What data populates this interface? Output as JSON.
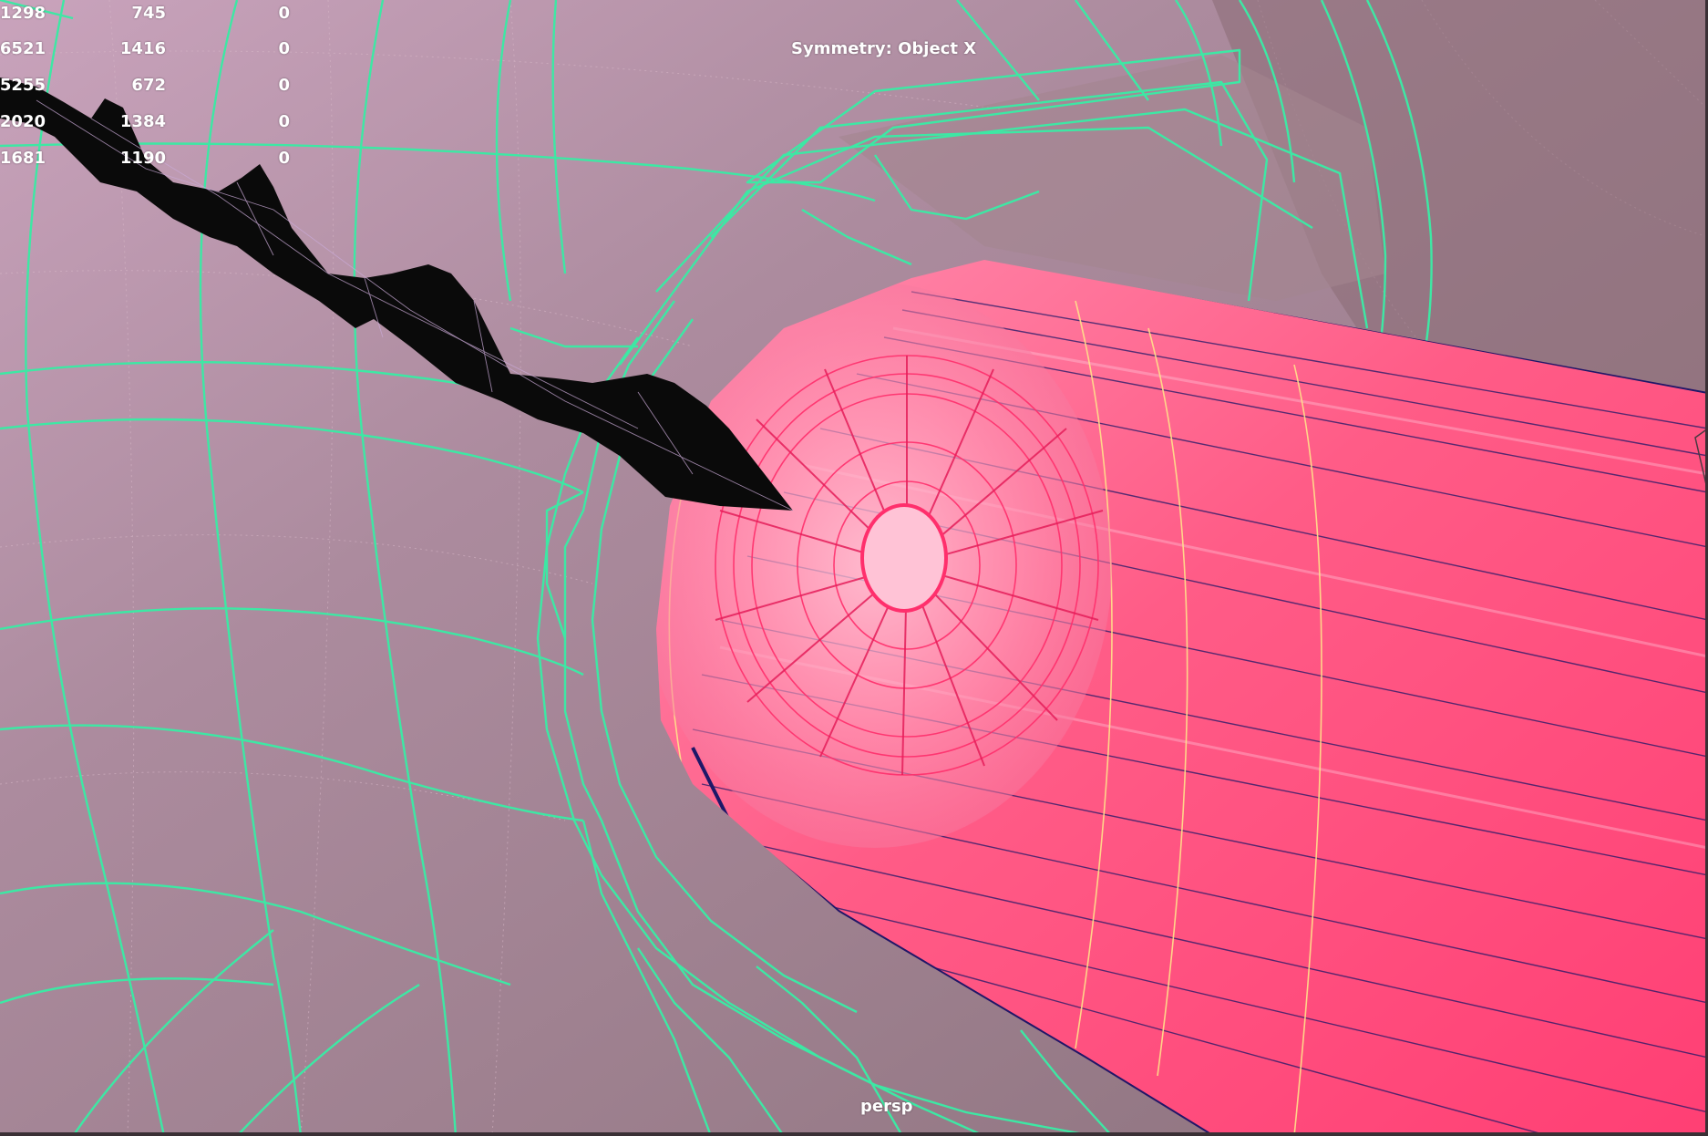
{
  "viewport": {
    "camera_name": "persp",
    "symmetry_label": "Symmetry: Object X"
  },
  "poly_count_hud": {
    "rows": [
      {
        "a": "1298",
        "b": "745",
        "c": "0"
      },
      {
        "a": "6521",
        "b": "1416",
        "c": "0"
      },
      {
        "a": "5255",
        "b": "672",
        "c": "0"
      },
      {
        "a": "2020",
        "b": "1384",
        "c": "0"
      },
      {
        "a": "1681",
        "b": "1190",
        "c": "0"
      }
    ]
  },
  "colors": {
    "background": "#a98a9c",
    "wireframe_selected": "#3de8a4",
    "eye_surface": "#ff5f8a",
    "eye_edges": "#1e1868",
    "eye_highlight": "#ffe38a",
    "dark_mesh": "#0a0a0a"
  }
}
